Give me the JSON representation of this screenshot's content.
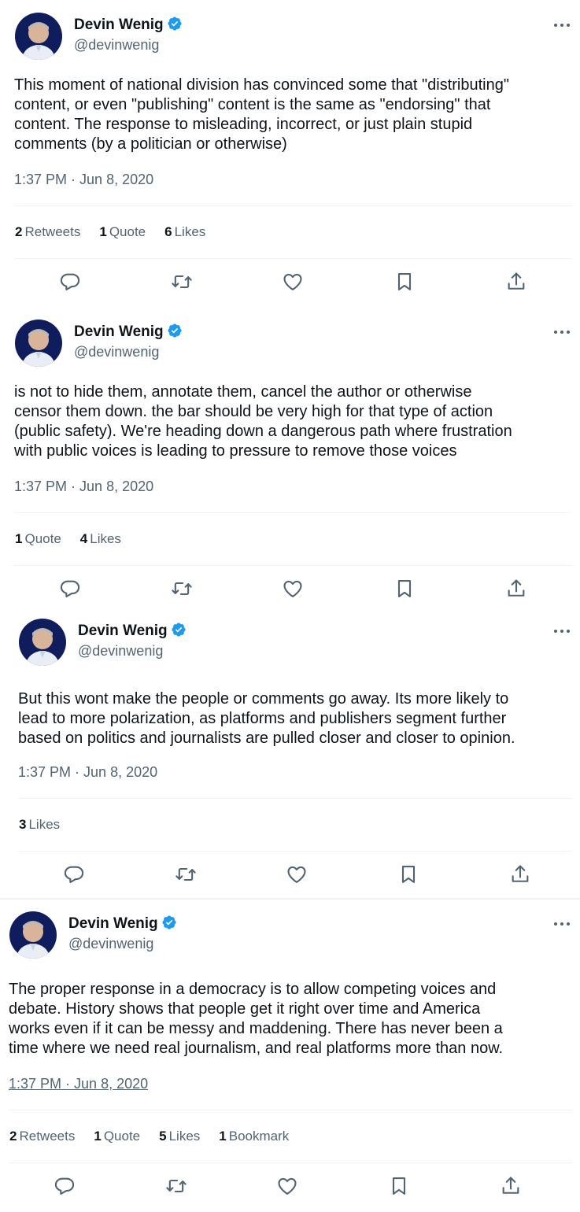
{
  "tweets": [
    {
      "author": "Devin Wenig",
      "handle": "@devinwenig",
      "text": "This moment of national division has convinced some that \"distributing\"\ncontent, or even \"publishing\" content is the same as \"endorsing\" that\ncontent. The response to misleading, incorrect, or just plain stupid\ncomments (by a politician or otherwise)",
      "time": "1:37 PM",
      "date": "Jun 8, 2020",
      "stats": [
        {
          "count": "2",
          "label": "Retweets"
        },
        {
          "count": "1",
          "label": "Quote"
        },
        {
          "count": "6",
          "label": "Likes"
        }
      ]
    },
    {
      "author": "Devin Wenig",
      "handle": "@devinwenig",
      "text": "is not to hide them, annotate them, cancel the author or otherwise\ncensor them down. the bar should be very high for that type of action\n(public safety). We're heading down a dangerous path where frustration\nwith public voices is leading to pressure to remove those voices",
      "time": "1:37 PM",
      "date": "Jun 8, 2020",
      "stats": [
        {
          "count": "1",
          "label": "Quote"
        },
        {
          "count": "4",
          "label": "Likes"
        }
      ]
    },
    {
      "author": "Devin Wenig",
      "handle": "@devinwenig",
      "text": "But this wont make the people or comments go away. Its more likely to\nlead to more polarization, as platforms and publishers segment further\nbased on politics and journalists are pulled closer and closer to opinion.",
      "time": "1:37 PM",
      "date": "Jun 8, 2020",
      "stats": [
        {
          "count": "3",
          "label": "Likes"
        }
      ]
    },
    {
      "author": "Devin Wenig",
      "handle": "@devinwenig",
      "text": "The proper response in a democracy is to allow competing voices and\ndebate. History shows that people get it right over time and America\nworks even if it can be messy and maddening. There has never been a\ntime where we need real journalism, and real platforms more than now.",
      "time": "1:37 PM",
      "date": "Jun 8, 2020",
      "stats": [
        {
          "count": "2",
          "label": "Retweets"
        },
        {
          "count": "1",
          "label": "Quote"
        },
        {
          "count": "5",
          "label": "Likes"
        },
        {
          "count": "1",
          "label": "Bookmark"
        }
      ]
    }
  ],
  "date_separator": " · ",
  "icons": [
    "reply-icon",
    "retweet-icon",
    "like-icon",
    "bookmark-icon",
    "share-icon"
  ],
  "colors": {
    "verified": "#1d9bf0",
    "text": "#0f1419",
    "secondary": "#536471",
    "divider": "#eff3f4"
  }
}
